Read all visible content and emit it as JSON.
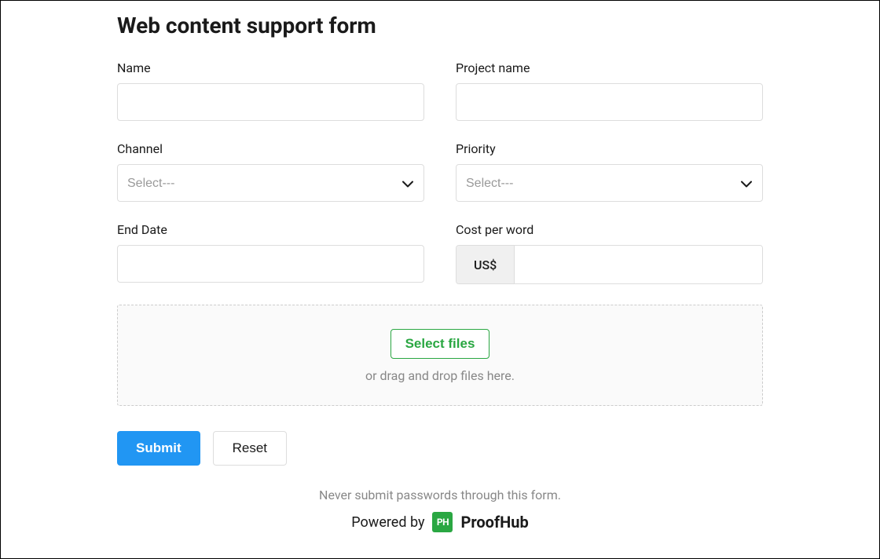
{
  "form": {
    "title": "Web content support form",
    "fields": {
      "name": {
        "label": "Name",
        "value": ""
      },
      "project_name": {
        "label": "Project name",
        "value": ""
      },
      "channel": {
        "label": "Channel",
        "placeholder": "Select---"
      },
      "priority": {
        "label": "Priority",
        "placeholder": "Select---"
      },
      "end_date": {
        "label": "End Date",
        "value": ""
      },
      "cost_per_word": {
        "label": "Cost per word",
        "currency_prefix": "US$",
        "value": ""
      }
    },
    "file_upload": {
      "button_label": "Select files",
      "hint_text": "or drag and drop files here."
    },
    "buttons": {
      "submit": "Submit",
      "reset": "Reset"
    },
    "footer": {
      "notice": "Never submit passwords through this form.",
      "powered_by_text": "Powered by",
      "logo_text": "PH",
      "brand_name": "ProofHub"
    }
  }
}
